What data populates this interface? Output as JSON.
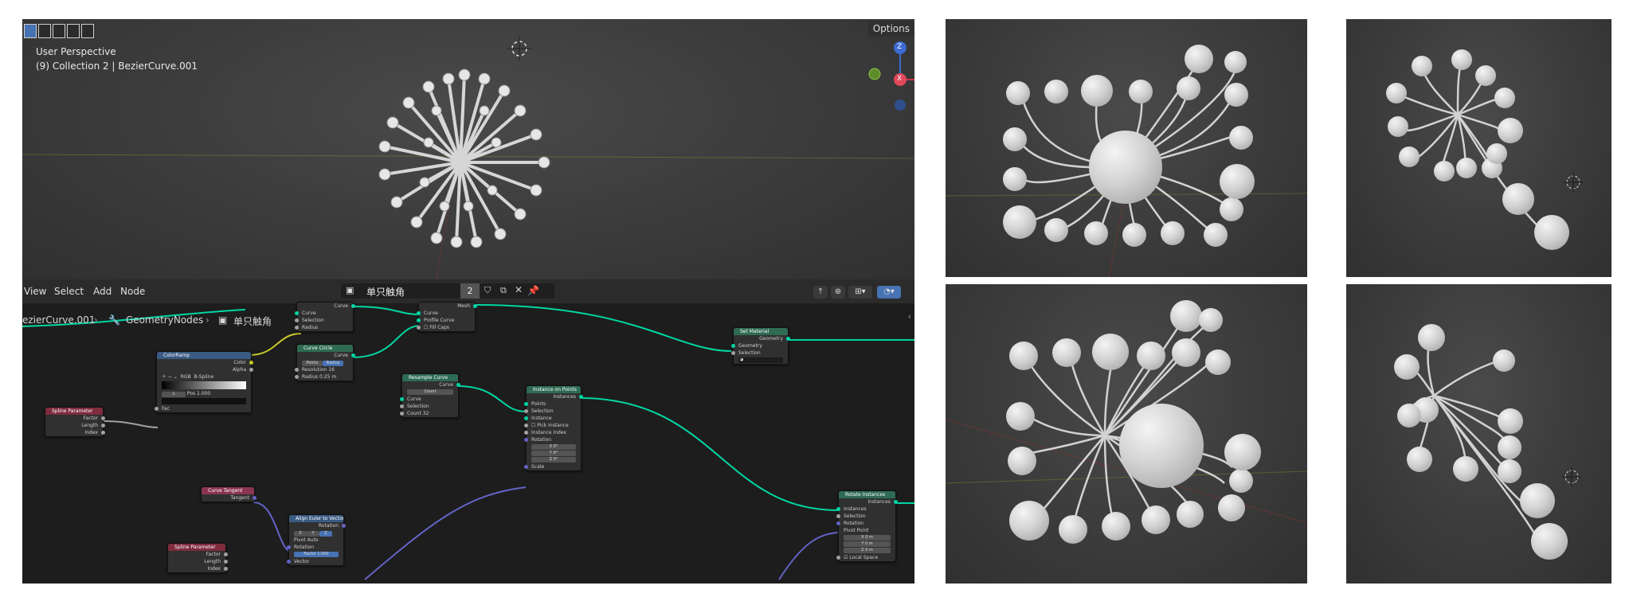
{
  "viewport": {
    "perspective_label": "User Perspective",
    "collection_label": "(9) Collection 2 | BezierCurve.001",
    "options_label": "Options",
    "gizmo": {
      "z": "Z",
      "x": "X"
    }
  },
  "node_editor": {
    "menu": {
      "view": "View",
      "select": "Select",
      "add": "Add",
      "node": "Node"
    },
    "nodegroup_name": "单只触角",
    "user_count": "2",
    "breadcrumb": {
      "object": "ezierCurve.001",
      "modifier": "GeometryNodes",
      "group": "单只触角"
    },
    "nodes": {
      "curve_to_mesh": {
        "out_mesh": "Mesh",
        "in_curve": "Curve",
        "in_profile": "Profile Curve",
        "fill_caps": "Fill Caps"
      },
      "top_group": {
        "out_curve": "Curve",
        "in_curve": "Curve",
        "in_selection": "Selection",
        "in_radius": "Radius"
      },
      "color_ramp": {
        "title": "ColorRamp",
        "out_color": "Color",
        "out_alpha": "Alpha",
        "mode": "RGB",
        "interp": "B-Spline",
        "pos_label": "Pos",
        "pos_value": "1.000",
        "index": "1",
        "in_fac": "Fac"
      },
      "curve_circle": {
        "title": "Curve Circle",
        "out_curve": "Curve",
        "mode_points": "Points",
        "mode_radius": "Radius",
        "resolution_label": "Resolution",
        "resolution_value": "16",
        "radius_label": "Radius",
        "radius_value": "0.25 m"
      },
      "spline_param_1": {
        "title": "Spline Parameter",
        "factor": "Factor",
        "length": "Length",
        "index": "Index"
      },
      "resample": {
        "title": "Resample Curve",
        "out_curve": "Curve",
        "mode": "Count",
        "in_curve": "Curve",
        "in_selection": "Selection",
        "count_label": "Count",
        "count_value": "32"
      },
      "instance_on_points": {
        "title": "Instance on Points",
        "out_instances": "Instances",
        "points": "Points",
        "selection": "Selection",
        "instance": "Instance",
        "pick_instance": "Pick Instance",
        "instance_index": "Instance Index",
        "rotation": "Rotation",
        "x": "X",
        "y": "Y",
        "z": "Z",
        "deg": "0°",
        "scale": "Scale"
      },
      "set_material": {
        "title": "Set Material",
        "out_geometry": "Geometry",
        "in_geometry": "Geometry",
        "in_selection": "Selection"
      },
      "curve_tangent": {
        "title": "Curve Tangent",
        "out_tangent": "Tangent"
      },
      "align_euler": {
        "title": "Align Euler to Vector",
        "out_rotation": "Rotation",
        "x": "X",
        "y": "Y",
        "z": "Z",
        "pivot_label": "Pivot",
        "pivot_value": "Auto",
        "in_rotation": "Rotation",
        "factor_label": "Factor",
        "factor_value": "1.000",
        "in_vector": "Vector"
      },
      "spline_param_2": {
        "title": "Spline Parameter",
        "factor": "Factor",
        "length": "Length",
        "index": "Index"
      },
      "rotate_instances": {
        "title": "Rotate Instances",
        "out_instances": "Instances",
        "instances": "Instances",
        "selection": "Selection",
        "rotation": "Rotation",
        "pivot_point": "Pivot Point",
        "x": "X",
        "y": "Y",
        "z": "Z",
        "m": "0 m",
        "local_space": "Local Space"
      }
    }
  },
  "colors": {
    "socket_geometry": "#00d6a3",
    "socket_float": "#a1a1a1",
    "socket_vector": "#6363c7",
    "socket_color": "#c7c729"
  }
}
